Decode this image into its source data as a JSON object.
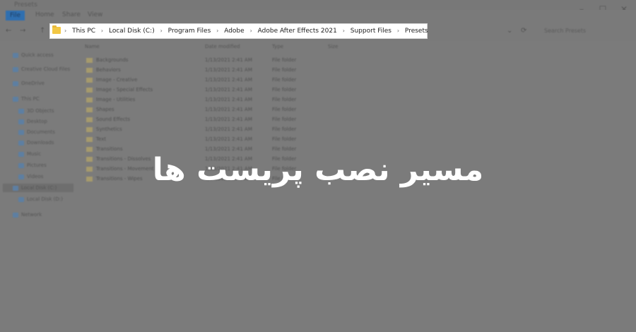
{
  "window": {
    "title": "Presets"
  },
  "ribbon": {
    "tabs": [
      "File",
      "Home",
      "Share",
      "View"
    ]
  },
  "nav": {
    "back": "←",
    "forward": "→",
    "up": "↑",
    "refresh": "⟳",
    "dropdown": "⌄"
  },
  "address": {
    "folder_icon": "folder-icon",
    "crumbs": [
      "This PC",
      "Local Disk (C:)",
      "Program Files",
      "Adobe",
      "Adobe After Effects 2021",
      "Support Files",
      "Presets"
    ],
    "separator": "›"
  },
  "search": {
    "placeholder": "Search Presets"
  },
  "sidebar": {
    "items": [
      "Quick access",
      "Creative Cloud Files",
      "OneDrive",
      "This PC",
      "3D Objects",
      "Desktop",
      "Documents",
      "Downloads",
      "Music",
      "Pictures",
      "Videos",
      "Local Disk (C:)",
      "Local Disk (D:)",
      "Network"
    ]
  },
  "columns": [
    "Name",
    "Date modified",
    "Type",
    "Size"
  ],
  "files": [
    {
      "name": "Backgrounds",
      "date": "1/13/2021 2:41 AM",
      "type": "File folder"
    },
    {
      "name": "Behaviors",
      "date": "1/13/2021 2:41 AM",
      "type": "File folder"
    },
    {
      "name": "Image - Creative",
      "date": "1/13/2021 2:41 AM",
      "type": "File folder"
    },
    {
      "name": "Image - Special Effects",
      "date": "1/13/2021 2:41 AM",
      "type": "File folder"
    },
    {
      "name": "Image - Utilities",
      "date": "1/13/2021 2:41 AM",
      "type": "File folder"
    },
    {
      "name": "Shapes",
      "date": "1/13/2021 2:41 AM",
      "type": "File folder"
    },
    {
      "name": "Sound Effects",
      "date": "1/13/2021 2:41 AM",
      "type": "File folder"
    },
    {
      "name": "Synthetics",
      "date": "1/13/2021 2:41 AM",
      "type": "File folder"
    },
    {
      "name": "Text",
      "date": "1/13/2021 2:41 AM",
      "type": "File folder"
    },
    {
      "name": "Transitions",
      "date": "1/13/2021 2:41 AM",
      "type": "File folder"
    },
    {
      "name": "Transitions - Dissolves",
      "date": "1/13/2021 2:41 AM",
      "type": "File folder"
    },
    {
      "name": "Transitions - Movement",
      "date": "1/13/2021 2:41 AM",
      "type": "File folder"
    },
    {
      "name": "Transitions - Wipes",
      "date": "1/13/2021 2:41 AM",
      "type": "File folder"
    }
  ],
  "overlay": {
    "title": "مسیر نصب پریست ها"
  },
  "colors": {
    "folder": "#f2c744",
    "overlay_text": "#ffffff",
    "dim": "#7b7b7b"
  }
}
